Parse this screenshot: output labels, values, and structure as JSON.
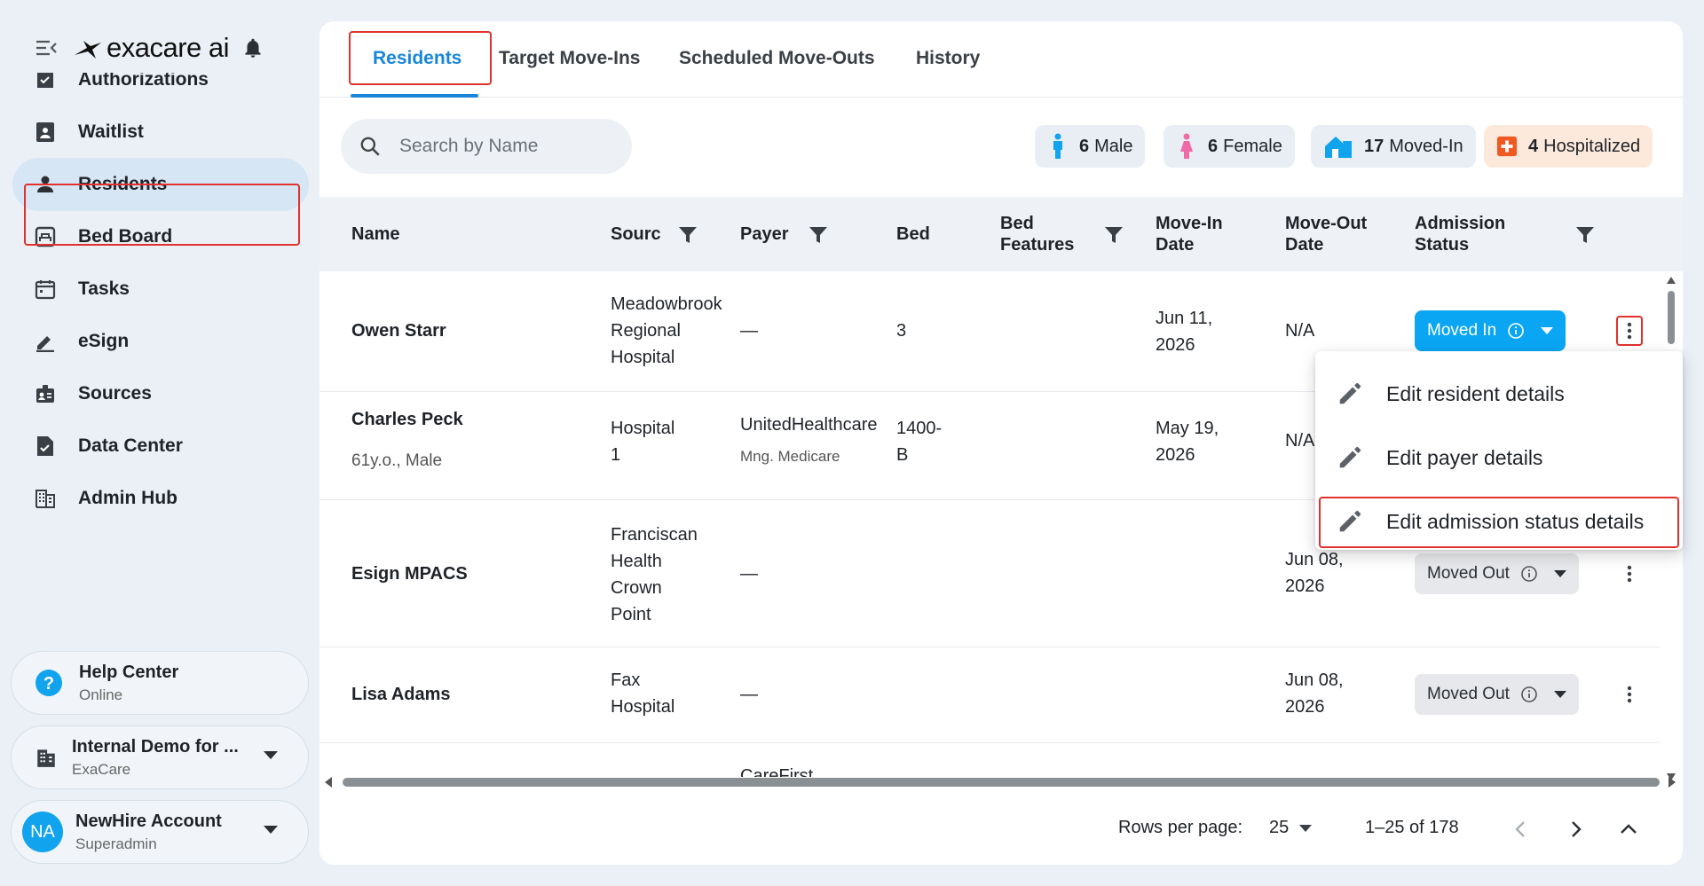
{
  "brand": {
    "name": "exacare ai"
  },
  "sidebar": {
    "items": [
      {
        "label": "Authorizations",
        "icon": "inbox-check-icon"
      },
      {
        "label": "Waitlist",
        "icon": "clipboard-person-icon"
      },
      {
        "label": "Residents",
        "icon": "person-icon",
        "active": true
      },
      {
        "label": "Bed Board",
        "icon": "bed-board-icon"
      },
      {
        "label": "Tasks",
        "icon": "calendar-icon"
      },
      {
        "label": "eSign",
        "icon": "pen-icon"
      },
      {
        "label": "Sources",
        "icon": "contact-card-icon"
      },
      {
        "label": "Data Center",
        "icon": "document-check-icon"
      },
      {
        "label": "Admin Hub",
        "icon": "building-grid-icon"
      }
    ],
    "help": {
      "title": "Help Center",
      "status": "Online"
    },
    "org": {
      "title": "Internal Demo for ...",
      "sub": "ExaCare"
    },
    "account": {
      "initials": "NA",
      "name": "NewHire Account",
      "role": "Superadmin"
    }
  },
  "tabs": [
    "Residents",
    "Target Move-Ins",
    "Scheduled Move-Outs",
    "History"
  ],
  "search": {
    "placeholder": "Search by Name"
  },
  "stats": [
    {
      "count": "6",
      "label": "Male"
    },
    {
      "count": "6",
      "label": "Female"
    },
    {
      "count": "17",
      "label": "Moved-In"
    },
    {
      "count": "4",
      "label": "Hospitalized"
    }
  ],
  "table": {
    "headers": {
      "name": "Name",
      "source": "Sourc",
      "payer": "Payer",
      "bed": "Bed",
      "bed_features_1": "Bed",
      "bed_features_2": "Features",
      "move_in_1": "Move-In",
      "move_in_2": "Date",
      "move_out_1": "Move-Out",
      "move_out_2": "Date",
      "status_1": "Admission",
      "status_2": "Status"
    },
    "rows": [
      {
        "name": "Owen Starr",
        "source": [
          "Meadowbrook",
          "Regional",
          "Hospital"
        ],
        "payer": "—",
        "bed": [
          "3"
        ],
        "move_in": [
          "Jun 11,",
          "2026"
        ],
        "move_out": [
          "N/A"
        ],
        "status": "Moved In"
      },
      {
        "name": "Charles Peck",
        "sub": "61y.o., Male",
        "source": [
          "Hospital",
          "1"
        ],
        "payer": "UnitedHealthcare",
        "payer_sub": "Mng. Medicare",
        "bed": [
          "1400-",
          "B"
        ],
        "move_in": [
          "May 19,",
          "2026"
        ],
        "move_out": [
          "N/A"
        ],
        "status": ""
      },
      {
        "name": "Esign MPACS",
        "source": [
          "Franciscan",
          "Health",
          "Crown",
          "Point"
        ],
        "payer": "—",
        "bed": [],
        "move_in": [],
        "move_out": [
          "Jun 08,",
          "2026"
        ],
        "status": "Moved Out"
      },
      {
        "name": "Lisa Adams",
        "source": [
          "Fax",
          "Hospital"
        ],
        "payer": "—",
        "bed": [],
        "move_in": [],
        "move_out": [
          "Jun 08,",
          "2026"
        ],
        "status": "Moved Out"
      },
      {
        "name": "",
        "source": [],
        "payer": "CareFirst",
        "bed": [],
        "move_in": [],
        "move_out": [],
        "status": ""
      }
    ]
  },
  "context_menu": [
    "Edit resident details",
    "Edit payer details",
    "Edit admission status details"
  ],
  "pagination": {
    "rows_label": "Rows per page:",
    "rows_value": "25",
    "range": "1–25 of 178"
  },
  "colors": {
    "accent": "#1a86d9",
    "moved_in": "#0aa6f4",
    "highlight": "#e0312b",
    "hospitalized_bg": "#fde9dc"
  }
}
